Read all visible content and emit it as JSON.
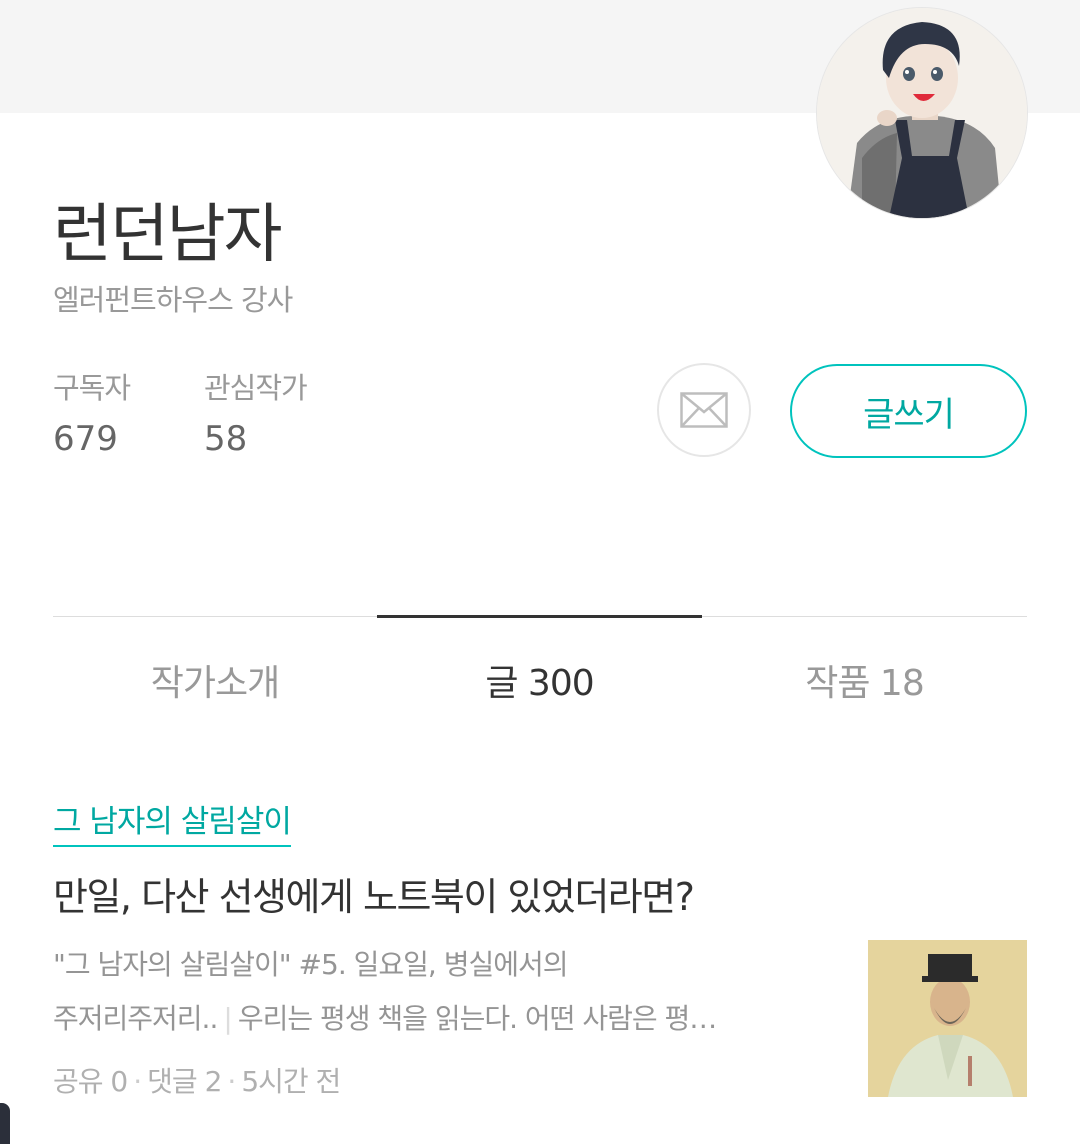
{
  "profile": {
    "name": "런던남자",
    "description": "엘러펀트하우스 강사",
    "avatar_icon": "avatar-illustration-icon"
  },
  "stats": {
    "subscribers_label": "구독자",
    "subscribers_value": "679",
    "favorites_label": "관심작가",
    "favorites_value": "58"
  },
  "actions": {
    "mail_icon": "envelope-icon",
    "write_label": "글쓰기"
  },
  "tabs": [
    {
      "label": "작가소개",
      "active": false
    },
    {
      "label": "글 300",
      "active": true
    },
    {
      "label": "작품 18",
      "active": false
    }
  ],
  "post": {
    "magazine": "그 남자의 살림살이",
    "title": "만일, 다산 선생에게 노트북이 있었더라면?",
    "excerpt_line1": "\"그 남자의 살림살이\" #5. 일요일, 병실에서의",
    "excerpt_subtitle_end": "주저리주저리..",
    "excerpt_separator": "|",
    "excerpt_body": "우리는 평생 책을 읽는다.  어떤 사람은 평…",
    "meta_share": "공유 0",
    "meta_comments": "댓글 2",
    "meta_time": "5시간 전",
    "meta_dot": "·",
    "thumbnail_icon": "portrait-painting-icon"
  },
  "colors": {
    "accent": "#00c3bd",
    "accent_text": "#00a8a1",
    "header_band": "#f5f5f5",
    "active_tab_bar": "#333333"
  }
}
